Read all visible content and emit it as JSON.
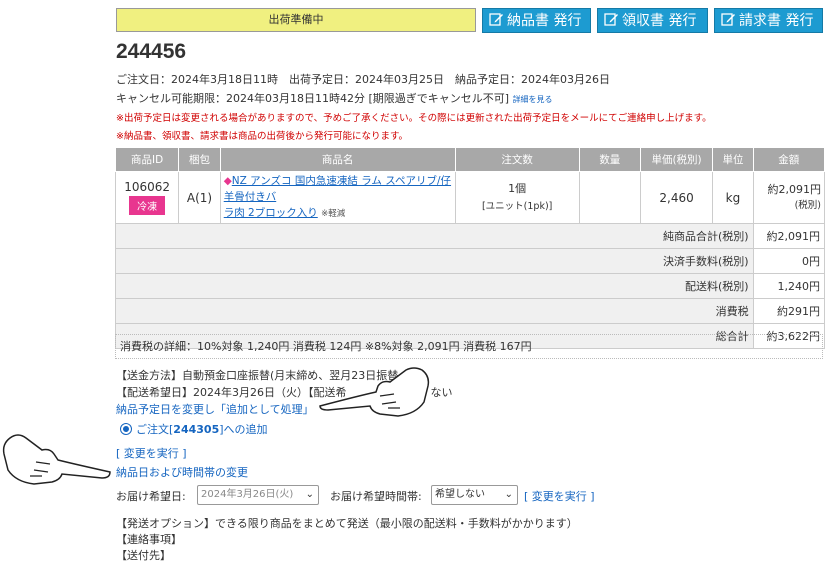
{
  "status_label": "出荷準備中",
  "buttons": {
    "delivery_note": "納品書 発行",
    "receipt": "領収書 発行",
    "invoice": "請求書 発行"
  },
  "order_number": "244456",
  "info": {
    "dates": "ご注文日：2024年3月18日11時　出荷予定日：2024年03月25日　納品予定日：2024年03月26日",
    "cancel": "キャンセル可能期限：2024年03月18日11時42分 [期限過ぎでキャンセル不可]",
    "cancel_detail_link": "詳細を見る",
    "notice1": "※出荷予定日は変更される場合がありますので、予めご了承ください。その際には更新された出荷予定日をメールにてご連絡申し上げます。",
    "notice2": "※納品書、領収書、請求書は商品の出荷後から発行可能になります。"
  },
  "table": {
    "headers": [
      "商品ID",
      "梱包",
      "商品名",
      "注文数",
      "数量",
      "単価(税別)",
      "単位",
      "金額"
    ],
    "item": {
      "id": "106062",
      "badge": "冷凍",
      "pack": "A(1)",
      "name_line1": "NZ アンズコ 国内急速凍結 ラム スペアリブ/仔羊骨付きバ",
      "name_line2": "ラ肉 2ブロック入り",
      "tax_note": "※軽減",
      "order_qty": "1個",
      "order_unit": "[ユニット(1pk)]",
      "qty": "",
      "unit_price": "2,460",
      "unit": "kg",
      "amount": "約2,091円",
      "amount_note": "(税別)"
    },
    "summary": [
      {
        "label": "純商品合計(税別)",
        "value": "約2,091円"
      },
      {
        "label": "決済手数料(税別)",
        "value": "0円"
      },
      {
        "label": "配送料(税別)",
        "value": "1,240円"
      },
      {
        "label": "消費税",
        "value": "約291円"
      },
      {
        "label": "総合計",
        "value": "約3,622円"
      }
    ]
  },
  "tax_detail": "消費税の詳細：10%対象 1,240円 消費税 124円 ※8%対象 2,091円 消費税 167円",
  "payment": "【送金方法】自動預金口座振替(月末締め、翌月23日振替",
  "delivery_wish": "【配送希望日】2024年3月26日（火）【配送希",
  "delivery_wish_tail": "ない",
  "change_link_process": "納品予定日を変更し「追加として処理」",
  "add_to_order_prefix": "ご注文[",
  "add_to_order_no": "244305",
  "add_to_order_suffix": "]への追加",
  "execute_change": "[ 変更を実行 ]",
  "change_datetime_link": "納品日および時間帯の変更",
  "delivery_date_label": "お届け希望日:",
  "delivery_date_value": "2024年3月26日(火)",
  "delivery_time_label": "お届け希望時間帯:",
  "delivery_time_value": "希望しない",
  "execute_change2": "[ 変更を実行 ]",
  "shipping_option": "【発送オプション】できる限り商品をまとめて発送（最小限の配送料・手数料がかかります）",
  "contact": "【連絡事項】",
  "ship_to": "【送付先】",
  "colors": {
    "accent": "#1d9bd1",
    "status_bg": "#f0f080",
    "badge": "#e8368f",
    "link": "#1565c0",
    "notice": "#d00000"
  }
}
